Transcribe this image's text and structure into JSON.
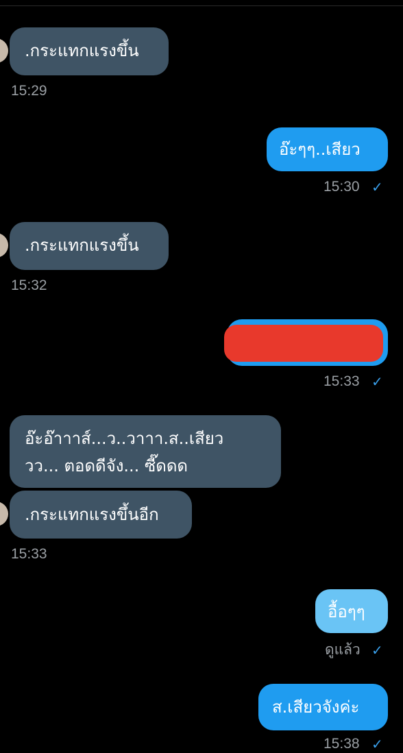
{
  "messages": [
    {
      "text": ".กระแทกแรงขึ้น",
      "time": "15:29"
    },
    {
      "text": "อ๊ะๆๆ..เสียว",
      "time": "15:30"
    },
    {
      "text": ".กระแทกแรงขึ้น",
      "time": "15:32"
    },
    {
      "text": "",
      "time": "15:33"
    },
    {
      "line1": "อ๊ะอ๊าาาส์...ว..วาาา.ส..เสียว",
      "line2": "วว... ตอดดีจัง... ซี๊ดดด"
    },
    {
      "text": ".กระแทกแรงขึ้นอีก",
      "time": "15:33"
    },
    {
      "text": "อื้อๆๆ",
      "status": "ดูแล้ว"
    },
    {
      "text": "ส.เสียวจังค่ะ",
      "time": "15:38"
    }
  ],
  "icons": {
    "read_check": "check-icon"
  },
  "colors": {
    "incoming": "#3f5465",
    "outgoing": "#1f9cf0",
    "outgoing_light": "#6ac4f5",
    "redaction": "#e8392c",
    "check": "#3aa0ec"
  }
}
